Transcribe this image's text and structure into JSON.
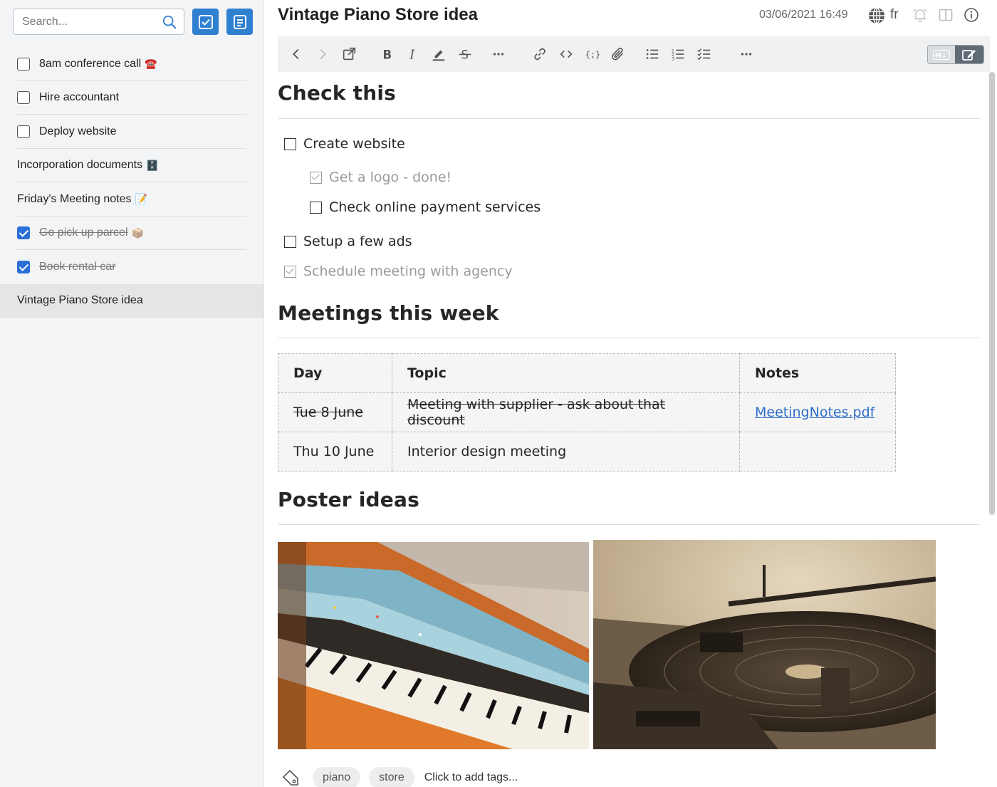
{
  "sidebar": {
    "search_placeholder": "Search...",
    "items": [
      {
        "label": "8am conference call",
        "emoji": "☎️",
        "type": "todo",
        "checked": false
      },
      {
        "label": "Hire accountant",
        "emoji": "",
        "type": "todo",
        "checked": false
      },
      {
        "label": "Deploy website",
        "emoji": "",
        "type": "todo",
        "checked": false
      },
      {
        "label": "Incorporation documents",
        "emoji": "🗄️",
        "type": "note"
      },
      {
        "label": "Friday's Meeting notes",
        "emoji": "📝",
        "type": "note"
      },
      {
        "label": "Go pick up parcel",
        "emoji": "📦",
        "type": "todo",
        "checked": true
      },
      {
        "label": "Book rental car",
        "emoji": "",
        "type": "todo",
        "checked": true
      },
      {
        "label": "Vintage Piano Store idea",
        "emoji": "",
        "type": "note",
        "selected": true
      }
    ]
  },
  "header": {
    "title": "Vintage Piano Store idea",
    "datetime": "03/06/2021 16:49",
    "language": "fr"
  },
  "toolbar": {
    "icons": [
      "back-icon",
      "forward-icon",
      "external-edit-icon",
      "bold-icon",
      "italic-icon",
      "highlight-icon",
      "strikethrough-icon",
      "more-icon",
      "link-icon",
      "inline-code-icon",
      "code-block-icon",
      "attach-icon",
      "bullet-list-icon",
      "numbered-list-icon",
      "checklist-icon",
      "more-icon"
    ],
    "accent": "#2f80d1"
  },
  "note": {
    "sections": {
      "check": {
        "heading": "Check this",
        "tasks": [
          {
            "text": "Create website",
            "checked": false,
            "indent": 0
          },
          {
            "text": "Get a logo - done!",
            "checked": true,
            "indent": 1
          },
          {
            "text": "Check online payment services",
            "checked": false,
            "indent": 1
          },
          {
            "text": "Setup a few ads",
            "checked": false,
            "indent": 0
          },
          {
            "text": "Schedule meeting with agency",
            "checked": true,
            "indent": 0
          }
        ]
      },
      "meetings": {
        "heading": "Meetings this week",
        "columns": [
          "Day",
          "Topic",
          "Notes"
        ],
        "rows": [
          {
            "day": "Tue 8 June",
            "topic": "Meeting with supplier - ask about that discount",
            "notes": "MeetingNotes.pdf",
            "strike": true
          },
          {
            "day": "Thu 10 June",
            "topic": "Interior design meeting",
            "notes": "",
            "strike": false
          }
        ]
      },
      "posters": {
        "heading": "Poster ideas"
      }
    }
  },
  "tags": {
    "items": [
      "piano",
      "store"
    ],
    "add_placeholder": "Click to add tags..."
  }
}
